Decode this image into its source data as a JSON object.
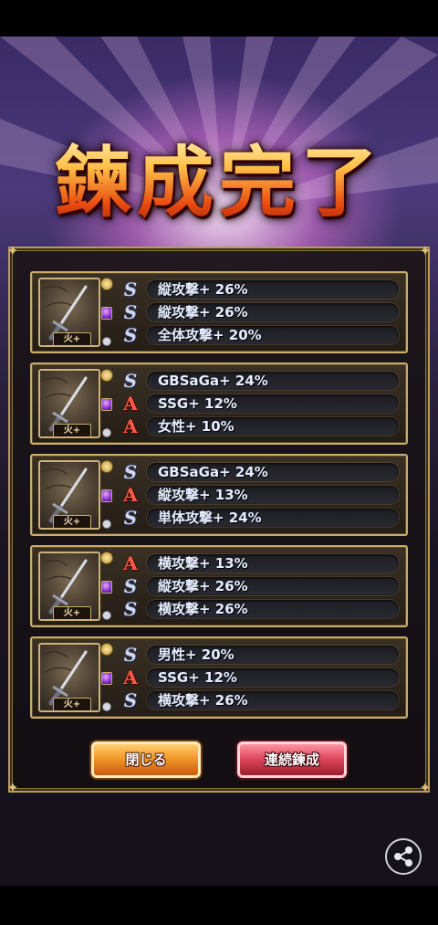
{
  "title": "鍊成完了",
  "element_badge": "火+",
  "cards": [
    {
      "skills": [
        {
          "rank": "S",
          "text": "縦攻撃+ 26%"
        },
        {
          "rank": "S",
          "text": "縦攻撃+ 26%"
        },
        {
          "rank": "S",
          "text": "全体攻撃+ 20%"
        }
      ]
    },
    {
      "skills": [
        {
          "rank": "S",
          "text": "GBSaGa+ 24%"
        },
        {
          "rank": "A",
          "text": "SSG+ 12%"
        },
        {
          "rank": "A",
          "text": "女性+ 10%"
        }
      ]
    },
    {
      "skills": [
        {
          "rank": "S",
          "text": "GBSaGa+ 24%"
        },
        {
          "rank": "A",
          "text": "縦攻撃+ 13%"
        },
        {
          "rank": "S",
          "text": "単体攻撃+ 24%"
        }
      ]
    },
    {
      "skills": [
        {
          "rank": "A",
          "text": "横攻撃+ 13%"
        },
        {
          "rank": "S",
          "text": "縦攻撃+ 26%"
        },
        {
          "rank": "S",
          "text": "横攻撃+ 26%"
        }
      ]
    },
    {
      "skills": [
        {
          "rank": "S",
          "text": "男性+ 20%"
        },
        {
          "rank": "A",
          "text": "SSG+ 12%"
        },
        {
          "rank": "S",
          "text": "横攻撃+ 26%"
        }
      ]
    }
  ],
  "buttons": {
    "close": "閉じる",
    "repeat": "連続鍊成"
  },
  "icons": {
    "share": "share-icon",
    "weapon": "sword-icon",
    "gem": "gem-icon"
  },
  "colors": {
    "rank_s": "#cfd8f2",
    "rank_a": "#ff5a4a",
    "frame_gold": "#c9ad69"
  }
}
